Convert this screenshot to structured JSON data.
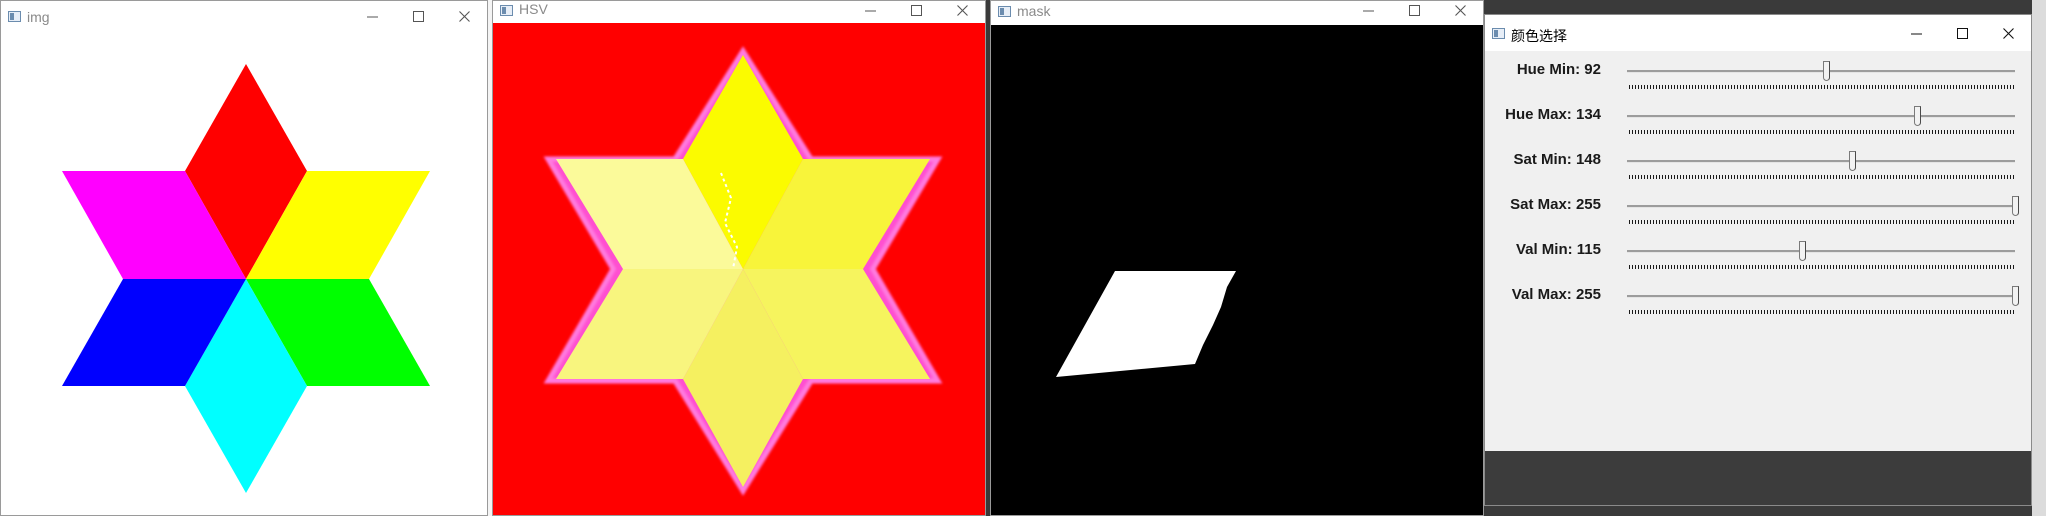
{
  "windows": {
    "img": {
      "title": "img"
    },
    "hsv": {
      "title": "HSV"
    },
    "mask": {
      "title": "mask"
    },
    "trackbars": {
      "title": "颜色选择"
    }
  },
  "trackbars": [
    {
      "label": "Hue Min: 92",
      "value": 92,
      "max": 179
    },
    {
      "label": "Hue Max: 134",
      "value": 134,
      "max": 179
    },
    {
      "label": "Sat Min: 148",
      "value": 148,
      "max": 255
    },
    {
      "label": "Sat Max: 255",
      "value": 255,
      "max": 255
    },
    {
      "label": "Val Min: 115",
      "value": 115,
      "max": 255
    },
    {
      "label": "Val Max: 255",
      "value": 255,
      "max": 255
    }
  ],
  "colors": {
    "hsv_background": "#ff0000",
    "star_red": "#ff0000",
    "star_yellow": "#ffff00",
    "star_green": "#00ff00",
    "star_cyan": "#00ffff",
    "star_blue": "#0000ff",
    "star_magenta": "#ff00ff",
    "mask_background": "#000000",
    "mask_foreground": "#ffffff"
  }
}
